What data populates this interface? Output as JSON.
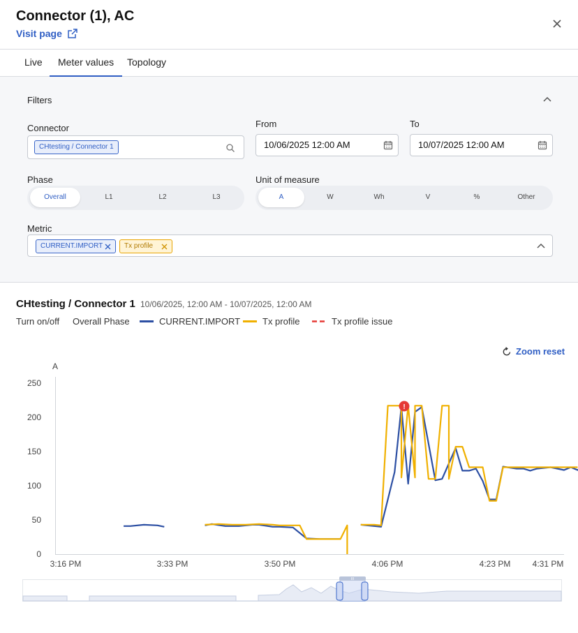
{
  "header": {
    "title": "Connector (1), AC",
    "visit_label": "Visit page"
  },
  "tabs": [
    {
      "label": "Live",
      "active": false
    },
    {
      "label": "Meter values",
      "active": true
    },
    {
      "label": "Topology",
      "active": false
    }
  ],
  "filters": {
    "title": "Filters",
    "connector": {
      "label": "Connector",
      "chip": "CHtesting / Connector 1"
    },
    "from": {
      "label": "From",
      "value": "10/06/2025 12:00 AM"
    },
    "to": {
      "label": "To",
      "value": "10/07/2025 12:00 AM"
    },
    "phase": {
      "label": "Phase",
      "options": [
        "Overall",
        "L1",
        "L2",
        "L3"
      ],
      "selected": "Overall"
    },
    "unit": {
      "label": "Unit of measure",
      "options": [
        "A",
        "W",
        "Wh",
        "V",
        "%",
        "Other"
      ],
      "selected": "A"
    },
    "metric": {
      "label": "Metric",
      "chips": [
        "CURRENT.IMPORT",
        "Tx profile"
      ]
    }
  },
  "chart": {
    "title": "CHtesting / Connector 1",
    "range": "10/06/2025, 12:00 AM - 10/07/2025, 12:00 AM",
    "toggle_label": "Turn on/off",
    "phase_label": "Overall Phase",
    "zoom_reset": "Zoom reset",
    "colors": {
      "current": "#2c4fa3",
      "tx": "#f0b000",
      "issue": "#e53935",
      "accent": "#2f5ec4"
    }
  },
  "chart_data": {
    "type": "line",
    "ylabel": "A",
    "ylim": [
      0,
      250
    ],
    "yticks": [
      0,
      50,
      100,
      150,
      200,
      250
    ],
    "xticks": [
      "3:16 PM",
      "3:33 PM",
      "3:50 PM",
      "4:06 PM",
      "4:23 PM",
      "4:31 PM"
    ],
    "series": [
      {
        "name": "CURRENT.IMPORT",
        "segments": [
          [
            [
              "15:26",
              41
            ],
            [
              "15:27",
              41
            ],
            [
              "15:29",
              43
            ],
            [
              "15:31",
              42
            ],
            [
              "15:32",
              40
            ]
          ],
          [
            [
              "15:38",
              42
            ],
            [
              "15:39",
              44
            ],
            [
              "15:41",
              41
            ],
            [
              "15:43",
              41
            ],
            [
              "15:45",
              43
            ],
            [
              "15:46",
              43
            ],
            [
              "15:48",
              40
            ],
            [
              "15:49",
              40
            ],
            [
              "15:51",
              39
            ],
            [
              "15:53",
              23
            ],
            [
              "15:55",
              22
            ],
            [
              "15:57",
              22
            ],
            [
              "15:58",
              22
            ]
          ],
          [
            [
              "16:01",
              43
            ],
            [
              "16:03",
              41
            ],
            [
              "16:04",
              40
            ],
            [
              "16:06",
              120
            ],
            [
              "16:07",
              215
            ],
            [
              "16:08",
              103
            ],
            [
              "16:09",
              208
            ],
            [
              "16:10",
              215
            ],
            [
              "16:12",
              108
            ],
            [
              "16:13",
              110
            ],
            [
              "16:15",
              155
            ],
            [
              "16:16",
              122
            ],
            [
              "16:17",
              122
            ],
            [
              "16:18",
              125
            ],
            [
              "16:19",
              107
            ],
            [
              "16:20",
              80
            ],
            [
              "16:21",
              80
            ],
            [
              "16:22",
              128
            ],
            [
              "16:24",
              125
            ],
            [
              "16:25",
              125
            ],
            [
              "16:26",
              122
            ],
            [
              "16:27",
              125
            ],
            [
              "16:29",
              127
            ],
            [
              "16:30",
              125
            ],
            [
              "16:31",
              123
            ],
            [
              "16:32",
              127
            ],
            [
              "16:33",
              123
            ],
            [
              "16:34",
              129
            ],
            [
              "16:35",
              122
            ],
            [
              "16:36",
              125
            ]
          ]
        ]
      },
      {
        "name": "Tx profile",
        "segments": [
          [
            [
              "15:38",
              43
            ],
            [
              "15:40",
              44
            ],
            [
              "15:42",
              43
            ],
            [
              "15:44",
              43
            ],
            [
              "15:46",
              44
            ],
            [
              "15:48",
              43
            ],
            [
              "15:49",
              42
            ],
            [
              "15:52",
              42
            ],
            [
              "15:53",
              22
            ],
            [
              "15:58",
              22
            ],
            [
              "15:59",
              42
            ],
            [
              "15:59",
              0
            ]
          ],
          [
            [
              "16:01",
              43
            ],
            [
              "16:03",
              43
            ],
            [
              "16:04",
              42
            ],
            [
              "16:05",
              217
            ],
            [
              "16:06",
              217
            ],
            [
              "16:07",
              217
            ],
            [
              "16:07",
              112
            ],
            [
              "16:08",
              217
            ],
            [
              "16:09",
              112
            ],
            [
              "16:09",
              217
            ],
            [
              "16:10",
              217
            ],
            [
              "16:11",
              110
            ],
            [
              "16:12",
              110
            ],
            [
              "16:13",
              217
            ],
            [
              "16:14",
              217
            ],
            [
              "16:14",
              110
            ],
            [
              "16:15",
              157
            ],
            [
              "16:16",
              157
            ],
            [
              "16:17",
              127
            ],
            [
              "16:18",
              127
            ],
            [
              "16:19",
              127
            ],
            [
              "16:20",
              78
            ],
            [
              "16:21",
              78
            ],
            [
              "16:22",
              127
            ],
            [
              "16:24",
              127
            ],
            [
              "16:33",
              127
            ]
          ],
          [
            [
              "16:45",
              217
            ],
            [
              "16:45",
              0
            ]
          ]
        ]
      },
      {
        "name": "Tx profile issue",
        "segments": [
          [
            [
              "16:36",
              217
            ],
            [
              "16:42",
              217
            ]
          ]
        ]
      }
    ]
  }
}
